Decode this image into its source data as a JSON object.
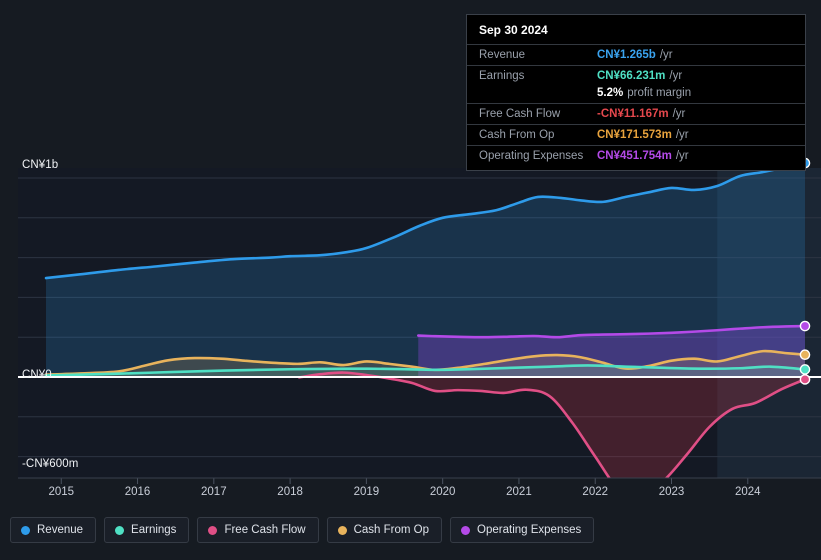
{
  "tooltip": {
    "title": "Sep 30 2024",
    "rows": [
      {
        "label": "Revenue",
        "value": "CN¥1.265b",
        "suffix": "/yr",
        "color": "#3aa3ef"
      },
      {
        "label": "Earnings",
        "value": "CN¥66.231m",
        "suffix": "/yr",
        "color": "#4fe0c4"
      },
      {
        "label": "",
        "value": "5.2%",
        "suffix": "profit margin",
        "color": "#ffffff"
      },
      {
        "label": "Free Cash Flow",
        "value": "-CN¥11.167m",
        "suffix": "/yr",
        "color": "#e5484d"
      },
      {
        "label": "Cash From Op",
        "value": "CN¥171.573m",
        "suffix": "/yr",
        "color": "#e8a33d"
      },
      {
        "label": "Operating Expenses",
        "value": "CN¥451.754m",
        "suffix": "/yr",
        "color": "#b44ae8"
      }
    ]
  },
  "legend": {
    "items": [
      {
        "label": "Revenue",
        "color": "#2e9bea"
      },
      {
        "label": "Earnings",
        "color": "#4fe0c4"
      },
      {
        "label": "Free Cash Flow",
        "color": "#e04f86"
      },
      {
        "label": "Cash From Op",
        "color": "#e8b35c"
      },
      {
        "label": "Operating Expenses",
        "color": "#b44ae8"
      }
    ]
  },
  "chart_data": {
    "type": "area",
    "title": "",
    "xlabel": "",
    "ylabel": "",
    "currency": "CN¥",
    "ylim": [
      -600,
      1000
    ],
    "yunit": "millions",
    "y_ticks": [
      {
        "label": "CN¥1b",
        "value": 1000
      },
      {
        "label": "CN¥0",
        "value": 0
      },
      {
        "label": "-CN¥600m",
        "value": -600
      }
    ],
    "x_ticks": [
      "2015",
      "2016",
      "2017",
      "2018",
      "2019",
      "2020",
      "2021",
      "2022",
      "2023",
      "2024"
    ],
    "x_range": [
      2014.8,
      2024.75
    ],
    "grid": true,
    "legend_position": "bottom",
    "forecast_band_start": "2023.6",
    "series": [
      {
        "name": "Revenue",
        "color": "#2e9bea",
        "fill": "rgba(46,155,234,0.20)",
        "x": [
          2014.8,
          2015.25,
          2015.75,
          2016.25,
          2016.75,
          2017.25,
          2017.75,
          2018.0,
          2018.4,
          2018.75,
          2019.0,
          2019.35,
          2019.7,
          2020.0,
          2020.35,
          2020.7,
          2021.0,
          2021.25,
          2021.55,
          2021.8,
          2022.1,
          2022.4,
          2022.7,
          2023.0,
          2023.3,
          2023.6,
          2023.9,
          2024.2,
          2024.5,
          2024.75
        ],
        "y": [
          497,
          516,
          538,
          556,
          575,
          592,
          600,
          607,
          612,
          628,
          648,
          700,
          760,
          800,
          818,
          838,
          876,
          905,
          900,
          888,
          880,
          905,
          928,
          950,
          940,
          960,
          1010,
          1030,
          1055,
          1075
        ]
      },
      {
        "name": "Operating Expenses",
        "color": "#b44ae8",
        "fill": "rgba(140,70,220,0.35)",
        "x": [
          2019.68,
          2019.9,
          2020.2,
          2020.55,
          2020.9,
          2021.2,
          2021.5,
          2021.8,
          2022.1,
          2022.4,
          2022.7,
          2023.0,
          2023.3,
          2023.6,
          2023.9,
          2024.2,
          2024.5,
          2024.75
        ],
        "y": [
          208,
          205,
          202,
          200,
          203,
          206,
          200,
          210,
          213,
          215,
          218,
          222,
          228,
          235,
          243,
          250,
          254,
          256
        ]
      },
      {
        "name": "Cash From Op",
        "color": "#e8b35c",
        "fill": "rgba(232,179,92,0.18)",
        "x": [
          2014.8,
          2015.25,
          2015.75,
          2016.1,
          2016.4,
          2016.75,
          2017.1,
          2017.4,
          2017.75,
          2018.1,
          2018.4,
          2018.7,
          2019.0,
          2019.3,
          2019.6,
          2019.9,
          2020.2,
          2020.55,
          2020.9,
          2021.2,
          2021.5,
          2021.8,
          2022.1,
          2022.4,
          2022.7,
          2023.0,
          2023.3,
          2023.6,
          2023.9,
          2024.2,
          2024.5,
          2024.75
        ],
        "y": [
          12,
          18,
          28,
          58,
          84,
          95,
          92,
          82,
          72,
          66,
          74,
          60,
          78,
          66,
          52,
          36,
          46,
          66,
          88,
          104,
          110,
          100,
          72,
          42,
          55,
          82,
          92,
          78,
          105,
          130,
          120,
          112
        ]
      },
      {
        "name": "Earnings",
        "color": "#4fe0c4",
        "fill": "rgba(79,224,196,0.14)",
        "x": [
          2014.8,
          2015.5,
          2016.2,
          2016.9,
          2017.6,
          2018.2,
          2018.8,
          2019.4,
          2019.9,
          2020.4,
          2020.9,
          2021.4,
          2021.9,
          2022.4,
          2022.9,
          2023.4,
          2023.9,
          2024.3,
          2024.75
        ],
        "y": [
          8,
          14,
          22,
          30,
          36,
          40,
          42,
          40,
          36,
          40,
          46,
          52,
          58,
          52,
          46,
          42,
          44,
          52,
          38
        ]
      },
      {
        "name": "Free Cash Flow",
        "color": "#e04f86",
        "fill": "rgba(190,50,70,0.28)",
        "x": [
          2018.12,
          2018.4,
          2018.7,
          2019.0,
          2019.3,
          2019.6,
          2019.9,
          2020.2,
          2020.5,
          2020.8,
          2021.1,
          2021.4,
          2021.7,
          2022.0,
          2022.3,
          2022.6,
          2022.9,
          2023.2,
          2023.5,
          2023.8,
          2024.1,
          2024.45,
          2024.75
        ],
        "y": [
          -2,
          14,
          22,
          10,
          -8,
          -30,
          -70,
          -66,
          -70,
          -80,
          -64,
          -96,
          -230,
          -400,
          -560,
          -600,
          -520,
          -390,
          -250,
          -160,
          -130,
          -60,
          -12
        ]
      }
    ]
  }
}
